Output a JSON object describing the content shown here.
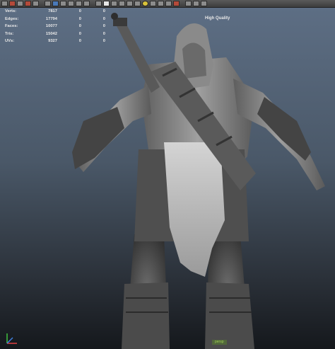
{
  "toolbar": {
    "icons": [
      "select-icon",
      "move-icon",
      "rotate-icon",
      "scale-icon",
      "render-icon",
      "light-icon",
      "camera-icon",
      "grid-icon",
      "wireframe-icon",
      "shaded-icon",
      "texture-icon",
      "lighting-icon",
      "shadow-icon",
      "xray-icon",
      "isolate-icon",
      "hud-icon"
    ]
  },
  "hud": {
    "rows": [
      {
        "label": "Verts:",
        "v1": "7817",
        "v2": "0",
        "v3": "0"
      },
      {
        "label": "Edges:",
        "v1": "17794",
        "v2": "0",
        "v3": "0"
      },
      {
        "label": "Faces:",
        "v1": "10077",
        "v2": "0",
        "v3": "0"
      },
      {
        "label": "Tris:",
        "v1": "15042",
        "v2": "0",
        "v3": "0"
      },
      {
        "label": "UVs:",
        "v1": "9327",
        "v2": "0",
        "v3": "0"
      }
    ]
  },
  "viewport": {
    "quality_label": "High Quality",
    "camera_label": "persp"
  },
  "colors": {
    "background_top": "#5d6e84",
    "background_bottom": "#15181c",
    "hud_text": "#e8e8e8",
    "model_base": "#8a8a8a"
  }
}
